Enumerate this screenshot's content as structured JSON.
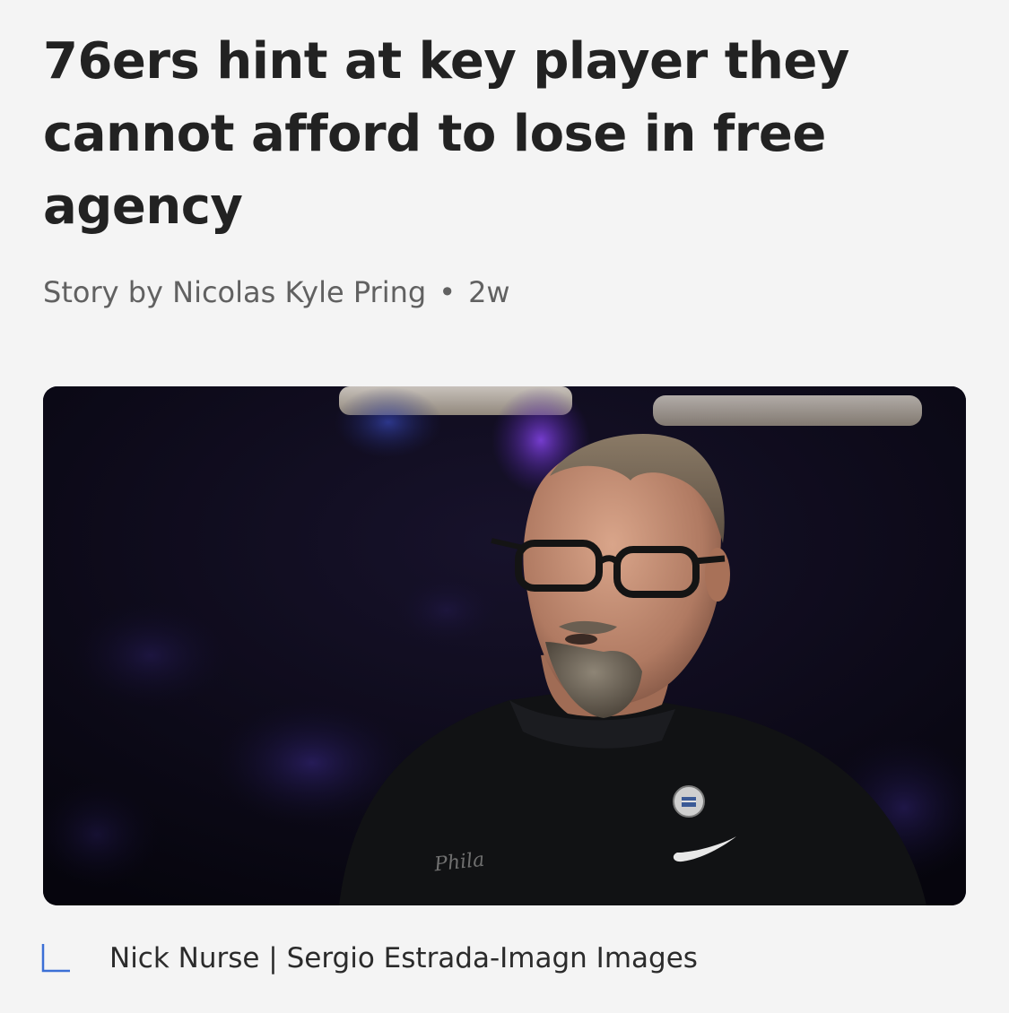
{
  "article": {
    "headline": "76ers hint at key player they cannot afford to lose in free agency",
    "byline": {
      "author": "Story by Nicolas Kyle Pring",
      "separator": "•",
      "age": "2w"
    },
    "hero_image": {
      "subject": "Nick Nurse on the sideline, dark arena background",
      "shirt_text": "Phila"
    },
    "caption": {
      "icon": "caption-corner-icon",
      "text": "Nick Nurse | Sergio Estrada-Imagn Images"
    }
  },
  "colors": {
    "background": "#f4f4f4",
    "headline": "#222222",
    "byline": "#616161",
    "caption_icon": "#3b6fd6"
  }
}
